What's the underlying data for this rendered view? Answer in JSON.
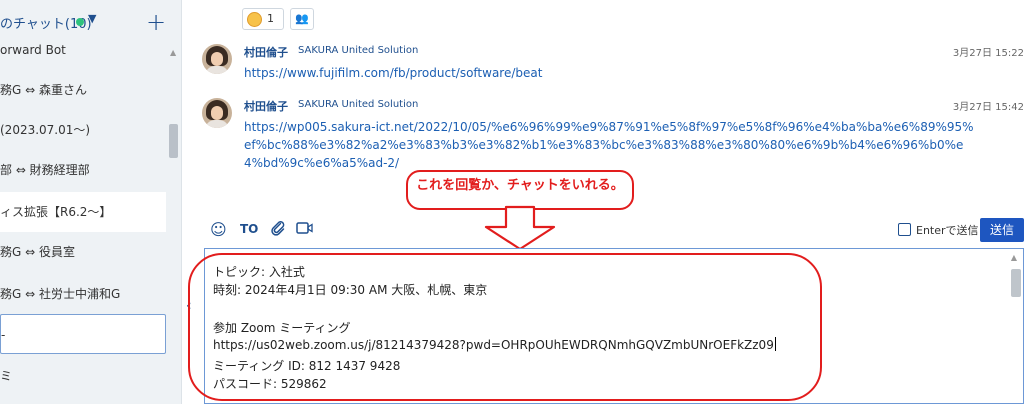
{
  "sidebar": {
    "title": "のチャット(10)",
    "items": [
      {
        "label": "orward Bot"
      },
      {
        "label": "務G ⇔ 森重さん"
      },
      {
        "label": "(2023.07.01〜)"
      },
      {
        "label": "部 ⇔ 財務経理部"
      },
      {
        "label": "ィス拡張【R6.2〜】"
      },
      {
        "label": "務G ⇔ 役員室"
      },
      {
        "label": "務G ⇔ 社労士中浦和G"
      },
      {
        "label": "-"
      },
      {
        "label": "ミ"
      }
    ]
  },
  "timeline": {
    "reaction_count": "1",
    "messages": [
      {
        "name": "村田倫子",
        "org": "SAKURA United Solution",
        "time": "3月27日 15:22",
        "link": "https://www.fujifilm.com/fb/product/software/beat"
      },
      {
        "name": "村田倫子",
        "org": "SAKURA United Solution",
        "time": "3月27日 15:42",
        "link": "https://wp005.sakura-ict.net/2022/10/05/%e6%96%99%e9%87%91%e5%8f%97%e5%8f%96%e4%ba%ba%e6%89%95%ef%bc%88%e3%82%a2%e3%83%b3%e3%82%b1%e3%83%bc%e3%83%88%e3%80%80%e6%9b%b4%e6%96%b0%e4%bd%9c%e6%a5%ad-2/"
      }
    ]
  },
  "annotation": {
    "text": "これを回覧か、チャットをいれる。"
  },
  "toolbar": {
    "to_label": "TO",
    "enter_label": "Enterで送信",
    "send_label": "送信"
  },
  "composer": {
    "lines": [
      "トピック: 入社式",
      "時刻: 2024年4月1日 09:30 AM 大阪、札幌、東京",
      "",
      "参加 Zoom ミーティング",
      "https://us02web.zoom.us/j/81214379428?pwd=OHRpOUhEWDRQNmhGQVZmbUNrOEFkZz09",
      "ミーティング ID: 812 1437 9428",
      "パスコード: 529862"
    ]
  },
  "colors": {
    "accent": "#1f4f8e",
    "send": "#1e56c0",
    "annotation": "#e21d1d",
    "online": "#2ec27e"
  }
}
